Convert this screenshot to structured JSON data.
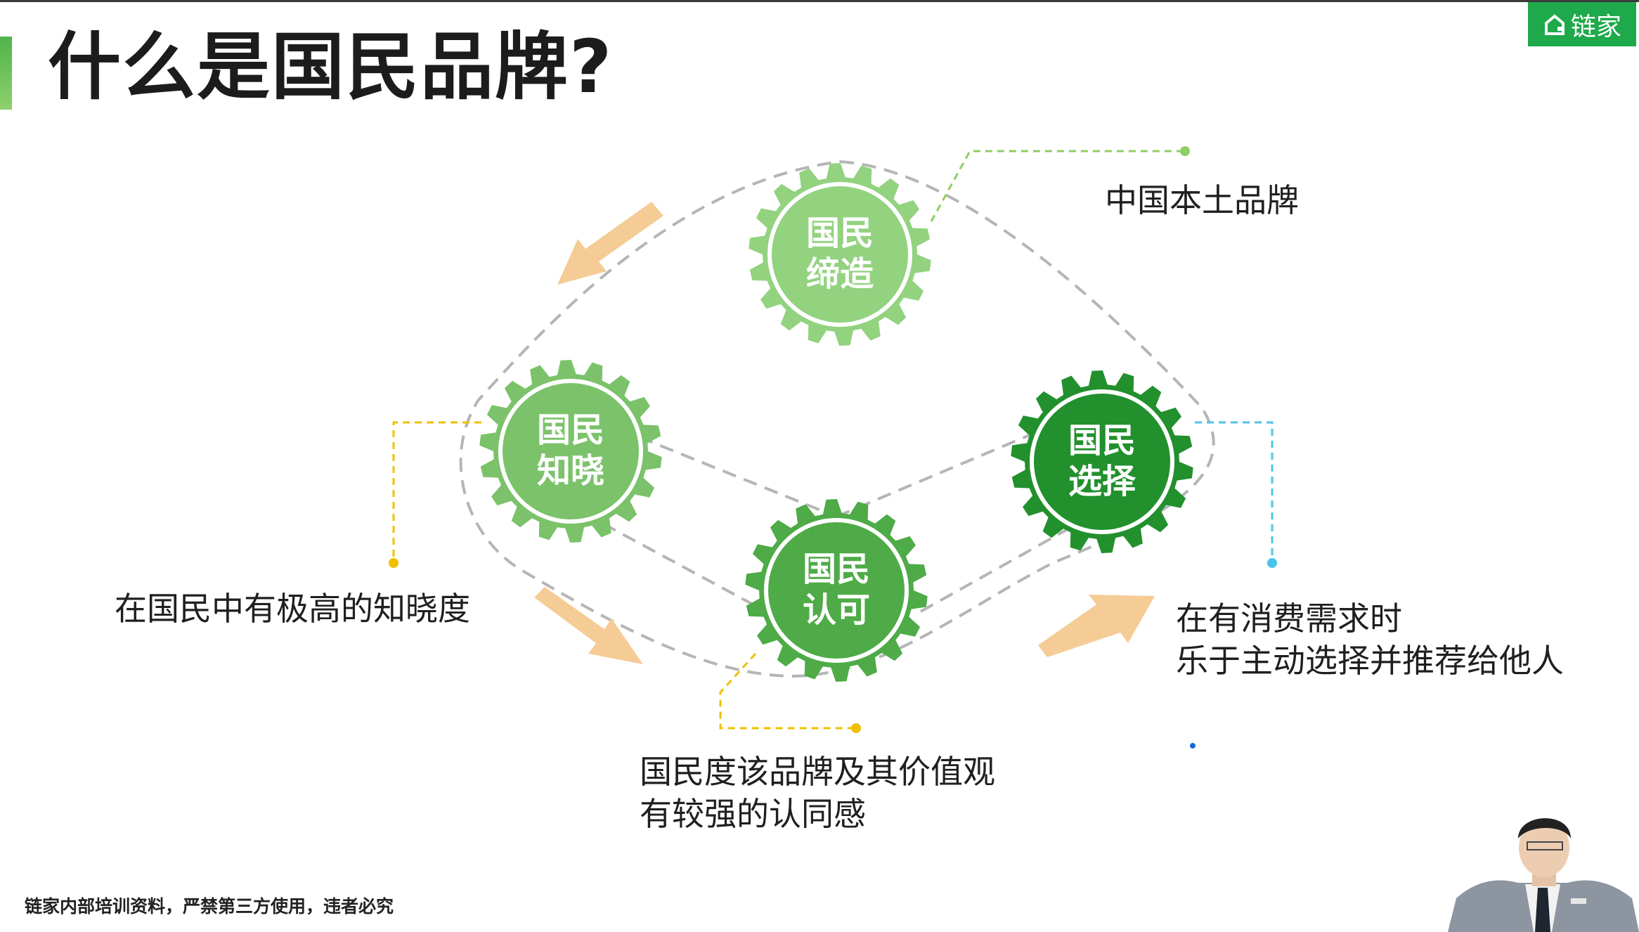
{
  "slide": {
    "title": "什么是国民品牌?",
    "brand": "链家",
    "footer": "链家内部培训资料，严禁第三方使用，违者必究"
  },
  "diagram": {
    "gears": [
      {
        "id": "create",
        "line1": "国民",
        "line2": "缔造",
        "color": "#93d27f"
      },
      {
        "id": "know",
        "line1": "国民",
        "line2": "知晓",
        "color": "#7bc26a"
      },
      {
        "id": "approve",
        "line1": "国民",
        "line2": "认可",
        "color": "#4eab47"
      },
      {
        "id": "choose",
        "line1": "国民",
        "line2": "选择",
        "color": "#22902d"
      }
    ],
    "descriptions": {
      "create": [
        "中国本土品牌"
      ],
      "know": [
        "在国民中有极高的知晓度"
      ],
      "approve": [
        "国民度该品牌及其价值观",
        "有较强的认同感"
      ],
      "choose": [
        "在有消费需求时",
        "乐于主动选择并推荐给他人"
      ]
    },
    "colors": {
      "arrow": "#f5cc95",
      "dashed_loop": "#b5b5b5",
      "leader_green": "#8fcf63",
      "leader_yellow": "#f0c000",
      "leader_blue": "#4cc3ea",
      "accent_dot": "#1a66d9"
    }
  }
}
